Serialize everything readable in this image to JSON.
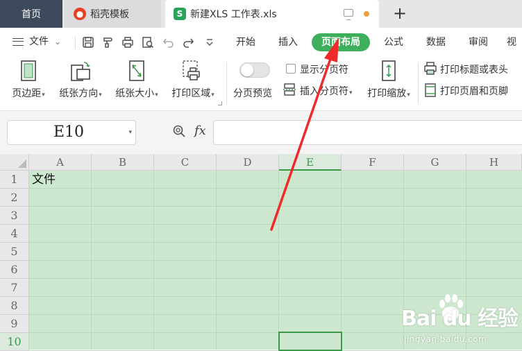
{
  "tabs": {
    "home": "首页",
    "template": "稻壳模板",
    "workbook": "新建XLS 工作表.xls",
    "workbook_logo": "S",
    "add": "+"
  },
  "menu": {
    "file": "文件",
    "tabs": [
      "开始",
      "插入",
      "页面布局",
      "公式",
      "数据",
      "审阅",
      "视图"
    ],
    "active_tab": "页面布局",
    "active_color": "#3eaf5c"
  },
  "ribbon": {
    "margins": "页边距",
    "orientation": "纸张方向",
    "paper_size": "纸张大小",
    "print_area": "打印区域",
    "page_break_preview": "分页预览",
    "show_page_break": "显示分页符",
    "insert_page_break": "插入分页符",
    "print_scale": "打印缩放",
    "print_titles": "打印标题或表头",
    "print_header_footer": "打印页眉和页脚"
  },
  "formula_bar": {
    "name_box": "E10",
    "fx": "fx",
    "formula": ""
  },
  "grid": {
    "columns": [
      "A",
      "B",
      "C",
      "D",
      "E",
      "F",
      "G",
      "H"
    ],
    "active_column": "E",
    "rows": [
      "1",
      "2",
      "3",
      "4",
      "5",
      "6",
      "7",
      "8",
      "9",
      "10"
    ],
    "active_row": "10",
    "cell_a1": "文件",
    "selected_cell": "E10",
    "fill_color": "#cde8cf"
  },
  "watermark": {
    "main": "Bai du 经验",
    "sub": "jingyan.baidu.com"
  }
}
